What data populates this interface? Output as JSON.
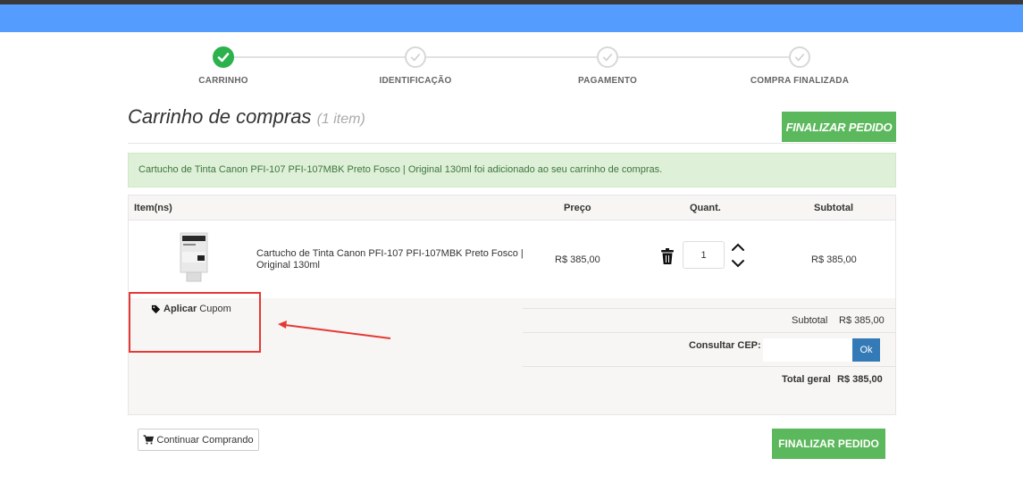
{
  "steps": [
    {
      "label": "CARRINHO",
      "state": "done"
    },
    {
      "label": "IDENTIFICAÇÃO",
      "state": "todo"
    },
    {
      "label": "PAGAMENTO",
      "state": "todo"
    },
    {
      "label": "COMPRA FINALIZADA",
      "state": "todo"
    }
  ],
  "page": {
    "title": "Carrinho de compras",
    "item_count": "(1 item)",
    "finalize_top": "FINALIZAR PEDIDO",
    "finalize_bottom": "FINALIZAR PEDIDO",
    "continue_shopping": "Continuar Comprando"
  },
  "alert": {
    "text": "Cartucho de Tinta Canon PFI-107 PFI-107MBK Preto Fosco | Original 130ml foi adicionado ao seu carrinho de compras."
  },
  "table": {
    "headers": {
      "item": "Item(ns)",
      "price": "Preço",
      "qty": "Quant.",
      "subtotal": "Subtotal"
    },
    "rows": [
      {
        "name": "Cartucho de Tinta Canon PFI-107 PFI-107MBK Preto Fosco | Original 130ml",
        "price": "R$ 385,00",
        "qty": "1",
        "subtotal": "R$ 385,00"
      }
    ]
  },
  "coupon": {
    "bold": "Aplicar",
    "rest": "Cupom"
  },
  "totals": {
    "subtotal_label": "Subtotal",
    "subtotal_value": "R$ 385,00",
    "cep_label": "Consultar CEP:",
    "cep_value": "",
    "cep_button": "Ok",
    "total_label": "Total geral",
    "total_value": "R$ 385,00"
  },
  "colors": {
    "topbar": "#559cff",
    "success": "#5cb85c",
    "check": "#2bb24c",
    "alert_bg": "#dff0d8",
    "highlight": "#e53935",
    "ok_button": "#337ab7"
  }
}
